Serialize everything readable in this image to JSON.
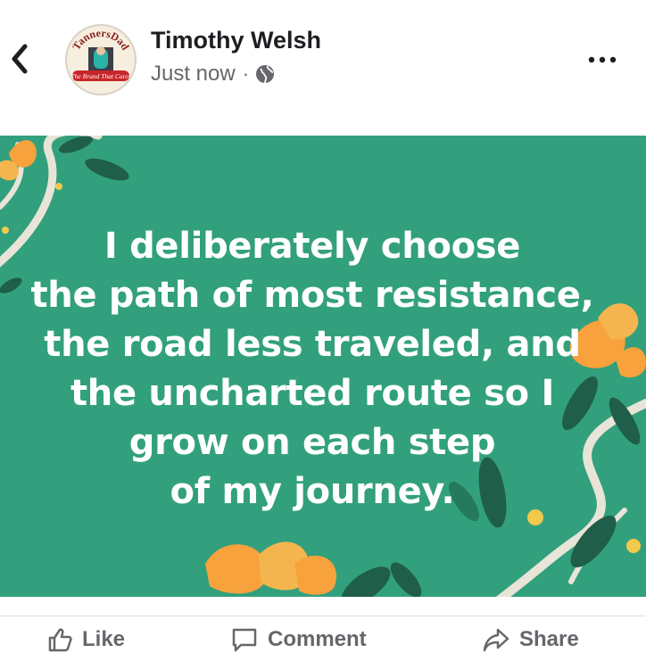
{
  "header": {
    "author_name": "Timothy Welsh",
    "timestamp": "Just now",
    "separator": "·",
    "privacy_icon": "globe-icon",
    "back_icon": "chevron-left-icon",
    "more_icon": "more-horizontal-icon",
    "avatar_logo_text_top": "TannersDad",
    "avatar_logo_text_bottom": "The Brand That Cares"
  },
  "post": {
    "background_color": "#2f9b78",
    "text_lines": [
      "I deliberately choose",
      "the path of most resistance,",
      "the road less traveled, and",
      "the uncharted route so I",
      "grow on each step",
      "of my journey."
    ]
  },
  "actions": {
    "like_label": "Like",
    "comment_label": "Comment",
    "share_label": "Share"
  },
  "colors": {
    "text_primary": "#1c1e21",
    "text_secondary": "#65676b",
    "accent_orange": "#f7a23c",
    "leaf_dark": "#1f5e48"
  }
}
